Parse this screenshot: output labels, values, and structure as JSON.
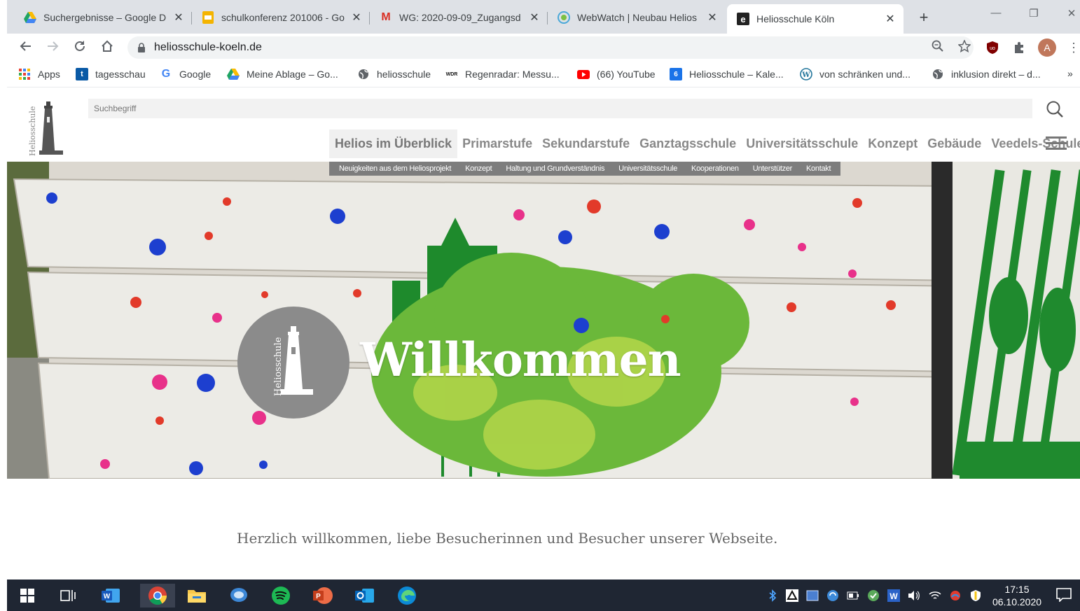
{
  "browser": {
    "tabs": [
      {
        "title": "Suchergebnisse – Google D",
        "icon": "google-drive-icon"
      },
      {
        "title": "schulkonferenz 201006 - Go",
        "icon": "google-slides-icon"
      },
      {
        "title": "WG: 2020-09-09_Zugangsd",
        "icon": "gmail-icon"
      },
      {
        "title": "WebWatch | Neubau Helios",
        "icon": "webwatch-icon"
      },
      {
        "title": "Heliosschule Köln",
        "icon": "heliosschule-icon",
        "active": true
      }
    ],
    "url": "heliosschule-koeln.de",
    "profile_initial": "A",
    "bookmarks": [
      {
        "label": "Apps",
        "icon": "apps-grid-icon"
      },
      {
        "label": "tagesschau",
        "icon": "tagesschau-icon"
      },
      {
        "label": "Google",
        "icon": "google-icon"
      },
      {
        "label": "Meine Ablage – Go...",
        "icon": "google-drive-icon"
      },
      {
        "label": "heliosschule",
        "icon": "globe-icon"
      },
      {
        "label": "Regenradar: Messu...",
        "icon": "wdr-icon"
      },
      {
        "label": "(66) YouTube",
        "icon": "youtube-icon"
      },
      {
        "label": "Heliosschule – Kale...",
        "icon": "calendar-icon"
      },
      {
        "label": "von schränken und...",
        "icon": "wordpress-icon"
      },
      {
        "label": "inklusion direkt – d...",
        "icon": "globe-icon"
      }
    ],
    "bookmarks_overflow": "»",
    "wdr_glyph": "WDR",
    "calendar_glyph": "6"
  },
  "site": {
    "logo_text": "Heliosschule",
    "search_placeholder": "Suchbegriff",
    "main_nav": [
      "Helios im Überblick",
      "Primarstufe",
      "Sekundarstufe",
      "Ganztagsschule",
      "Universitätsschule",
      "Konzept",
      "Gebäude",
      "Veedels-Schule"
    ],
    "sub_nav": [
      "Neuigkeiten aus dem Heliosprojekt",
      "Konzept",
      "Haltung und Grundverständnis",
      "Universitätsschule",
      "Kooperationen",
      "Unterstützer",
      "Kontakt"
    ],
    "hero_title": "Willkommen",
    "intro": "Herzlich willkommen, liebe Besucherinnen und Besucher unserer Webseite."
  },
  "taskbar": {
    "time": "17:15",
    "date": "06.10.2020",
    "apps": [
      "windows-start-icon",
      "task-view-icon",
      "word-icon",
      "chrome-icon",
      "file-explorer-icon",
      "feedback-icon",
      "spotify-icon",
      "powerpoint-icon",
      "outlook-icon",
      "edge-icon"
    ]
  },
  "colors": {
    "nav_text": "#888888",
    "subnav_bg": "#7d7d7d",
    "taskbar_bg": "#1f2633",
    "logo_circle": "#8b8b8b"
  }
}
